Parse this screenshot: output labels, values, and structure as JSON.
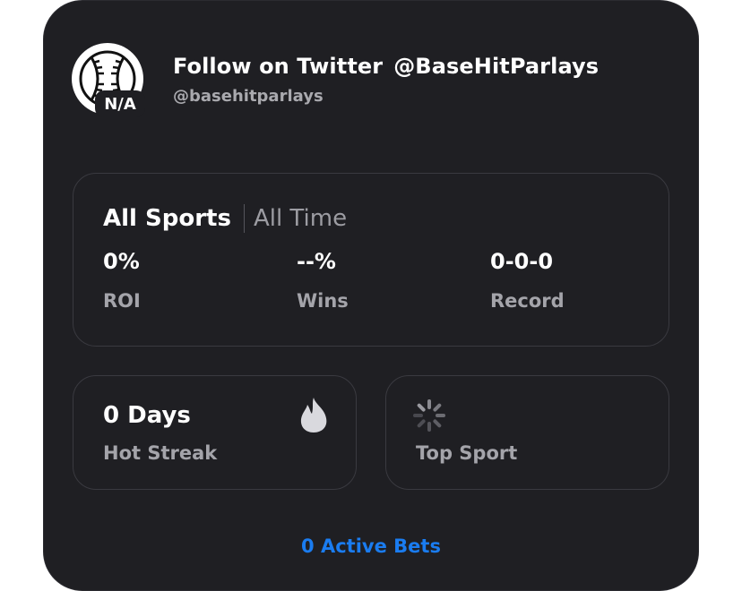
{
  "profile": {
    "title": "Follow on Twitter",
    "twitter_handle": "@BaseHitParlays",
    "username": "@basehitparlays",
    "badge": "N/A",
    "avatar_icon": "baseball-icon"
  },
  "stats": {
    "sport": "All Sports",
    "period": "All Time",
    "items": [
      {
        "value": "0%",
        "label": "ROI"
      },
      {
        "value": "--%",
        "label": "Wins"
      },
      {
        "value": "0-0-0",
        "label": "Record"
      }
    ]
  },
  "streak": {
    "value": "0 Days",
    "label": "Hot Streak",
    "icon": "flame-icon"
  },
  "top_sport": {
    "label": "Top Sport",
    "icon": "loading-spinner-icon"
  },
  "active_bets": {
    "label": "0 Active Bets"
  },
  "colors": {
    "card": "#1f1f23",
    "accent": "#1a7cf0",
    "muted": "#a4a4aa"
  }
}
